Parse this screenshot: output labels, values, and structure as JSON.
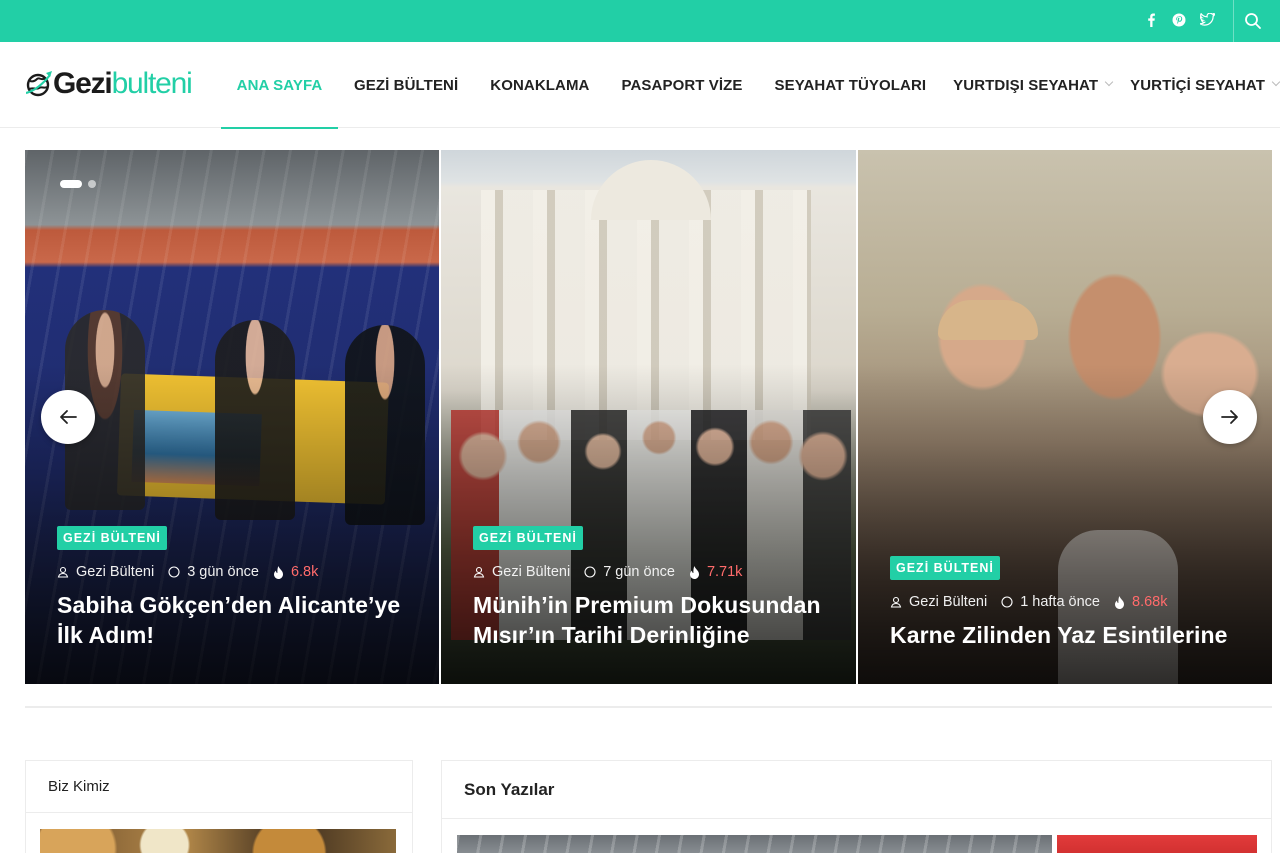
{
  "topbar": {
    "social": [
      {
        "icon": "facebook-icon",
        "glyph": "f"
      },
      {
        "icon": "pinterest-icon",
        "glyph": "℗"
      },
      {
        "icon": "twitter-icon",
        "glyph": "🐦"
      }
    ],
    "search_icon": "search-icon"
  },
  "logo": {
    "part1": "Gezi",
    "part2": "bulteni"
  },
  "nav": {
    "items": [
      {
        "label": "ANA SAYFA",
        "active": true
      },
      {
        "label": "GEZİ BÜLTENİ"
      },
      {
        "label": "KONAKLAMA"
      },
      {
        "label": "PASAPORT VİZE"
      },
      {
        "label": "SEYAHAT TÜYOLARI"
      },
      {
        "label": "YURTDIŞI SEYAHAT",
        "dropdown": true
      },
      {
        "label": "YURTİÇİ SEYAHAT",
        "dropdown": true
      }
    ]
  },
  "slides": [
    {
      "category": "GEZİ BÜLTENİ",
      "author": "Gezi Bülteni",
      "time": "3 gün önce",
      "views": "6.8k",
      "title": "Sabiha Gökçen’den Alicante’ye İlk Adım!"
    },
    {
      "category": "GEZİ BÜLTENİ",
      "author": "Gezi Bülteni",
      "time": "7 gün önce",
      "views": "7.71k",
      "title": "Münih’in Premium Dokusundan Mısır’ın Tarihi Derinliğine"
    },
    {
      "category": "GEZİ BÜLTENİ",
      "author": "Gezi Bülteni",
      "time": "1 hafta önce",
      "views": "8.68k",
      "title": "Karne Zilinden Yaz Esintilerine"
    }
  ],
  "widgets": {
    "left_title": "Biz Kimiz",
    "right_title": "Son Yazılar"
  },
  "colors": {
    "accent": "#22cfa6",
    "views": "#ff6b6b"
  }
}
